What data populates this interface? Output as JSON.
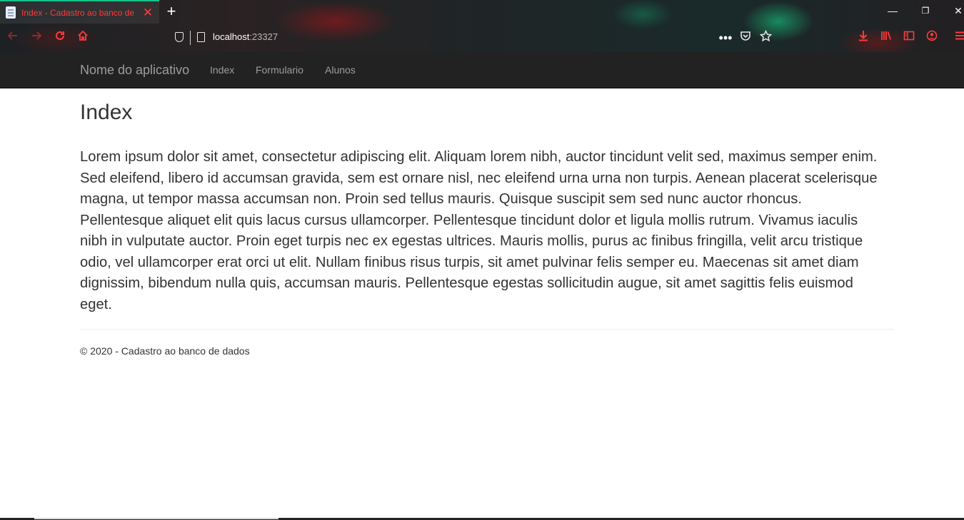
{
  "browser": {
    "tab": {
      "title": "Index - Cadastro ao banco de dados",
      "close_glyph": "✕"
    },
    "new_tab_glyph": "+",
    "window_controls": {
      "minimize": "—",
      "restore": "❐",
      "close": "✕"
    },
    "url": {
      "host": "localhost",
      "port": ":23327"
    },
    "icons": [
      "back-icon",
      "forward-icon",
      "reload-icon",
      "home-icon",
      "shield-icon",
      "page-icon",
      "more-icon",
      "pocket-icon",
      "bookmark-star-icon",
      "download-icon",
      "library-icon",
      "sidebar-icon",
      "account-icon",
      "menu-icon"
    ],
    "accent_color": "#ff3b3b"
  },
  "navbar": {
    "brand": "Nome do aplicativo",
    "links": [
      "Index",
      "Formulario",
      "Alunos"
    ]
  },
  "main": {
    "title": "Index",
    "paragraph": "Lorem ipsum dolor sit amet, consectetur adipiscing elit. Aliquam lorem nibh, auctor tincidunt velit sed, maximus semper enim. Sed eleifend, libero id accumsan gravida, sem est ornare nisl, nec eleifend urna urna non turpis. Aenean placerat scelerisque magna, ut tempor massa accumsan non. Proin sed tellus mauris. Quisque suscipit sem sed nunc auctor rhoncus. Pellentesque aliquet elit quis lacus cursus ullamcorper. Pellentesque tincidunt dolor et ligula mollis rutrum. Vivamus iaculis nibh in vulputate auctor. Proin eget turpis nec ex egestas ultrices. Mauris mollis, purus ac finibus fringilla, velit arcu tristique odio, vel ullamcorper erat orci ut elit. Nullam finibus risus turpis, sit amet pulvinar felis semper eu. Maecenas sit amet diam dignissim, bibendum nulla quis, accumsan mauris. Pellentesque egestas sollicitudin augue, sit amet sagittis felis euismod eget."
  },
  "footer": {
    "text": "© 2020 - Cadastro ao banco de dados"
  }
}
